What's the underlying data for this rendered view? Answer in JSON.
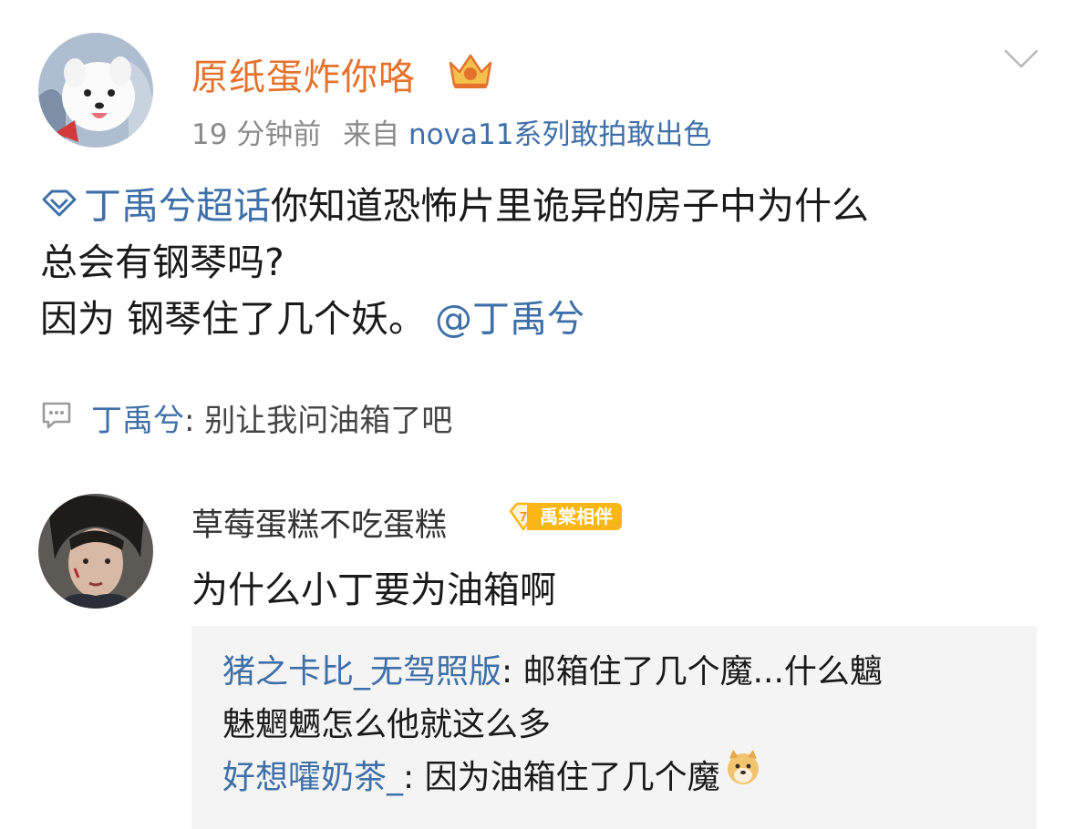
{
  "post": {
    "author": "原纸蛋炸你咯",
    "badge_icon": "crown-vip-icon",
    "time": "19 分钟前",
    "source_prefix": "来自",
    "source": "nova11系列敢拍敢出色",
    "topic_link": "丁禹兮超话",
    "text_line1": "你知道恐怖片里诡异的房子中为什么",
    "text_line2": "总会有钢琴吗?",
    "text_line3": "因为 钢琴住了几个妖。",
    "mention": "@丁禹兮",
    "comment_author": "丁禹兮",
    "comment_text": ": 别让我问油箱了吧"
  },
  "reply": {
    "author": "草莓蛋糕不吃蛋糕",
    "fan_level": "7",
    "fan_badge": "禹棠相伴",
    "text": "为什么小丁要为油箱啊",
    "subreplies": [
      {
        "author": "猪之卡比_无驾照版",
        "text_line1": ": 邮箱住了几个魔...什么魑",
        "text_line2": "魅魍魉怎么他就这么多"
      },
      {
        "author": "好想嚯奶茶_",
        "text": ": 因为油箱住了几个魔",
        "emoji": "doge-emoji"
      }
    ]
  },
  "colors": {
    "author_orange": "#e5722c",
    "link_blue": "#3f6fa8",
    "meta_gray": "#8a8a8a",
    "badge_yellow": "#f8b716",
    "subbox_bg": "#f4f4f4"
  }
}
